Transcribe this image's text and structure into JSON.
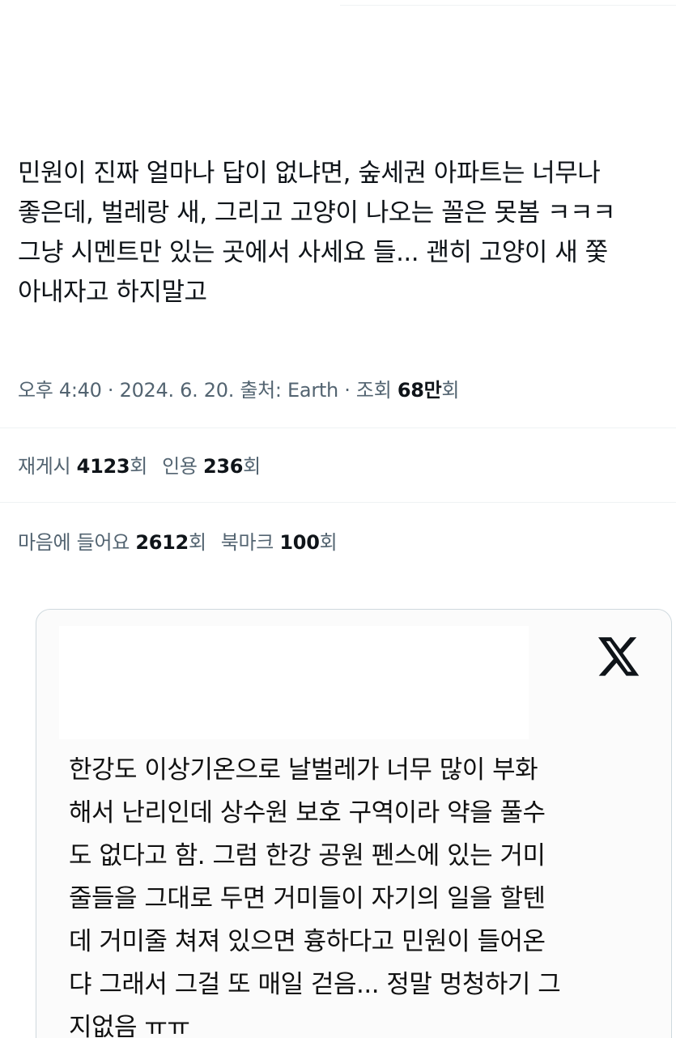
{
  "tweet": {
    "lines": [
      "민원이 진짜 얼마나 답이 없냐면, 숲세권 아파트는 너무나",
      "좋은데, 벌레랑 새, 그리고 고양이 나오는 꼴은 못봄 ㅋㅋㅋ",
      "그냥 시멘트만 있는 곳에서 사세요 들... 괜히 고양이 새 쫓",
      "아내자고 하지말고"
    ]
  },
  "meta": {
    "time": "오후 4:40",
    "sep1": " · ",
    "date": "2024. 6. 20.",
    "sep2": " ",
    "source_label": "출처: Earth",
    "sep3": " · ",
    "views_label": "조회 ",
    "views_count": "68만",
    "views_suffix": "회"
  },
  "stats": {
    "reposts_label": "재게시 ",
    "reposts_count": "4123",
    "reposts_suffix": "회",
    "quotes_label": "인용 ",
    "quotes_count": "236",
    "quotes_suffix": "회",
    "likes_label": "마음에 들어요 ",
    "likes_count": "2612",
    "likes_suffix": "회",
    "bookmarks_label": "북마크 ",
    "bookmarks_count": "100",
    "bookmarks_suffix": "회"
  },
  "quote_card": {
    "logo_icon": "x-logo-icon",
    "lines": [
      "한강도 이상기온으로 날벌레가 너무 많이 부화",
      "해서 난리인데 상수원 보호 구역이라 약을 풀수",
      "도 없다고 함. 그럼 한강 공원 펜스에 있는 거미",
      "줄들을 그대로 두면 거미들이 자기의 일을 할텐",
      "데 거미줄 쳐져 있으면 흉하다고 민원이 들어온",
      "댜 그래서 그걸 또 매일 걷음... 정말 멍청하기 그",
      "지없음 ㅠㅠ"
    ]
  }
}
